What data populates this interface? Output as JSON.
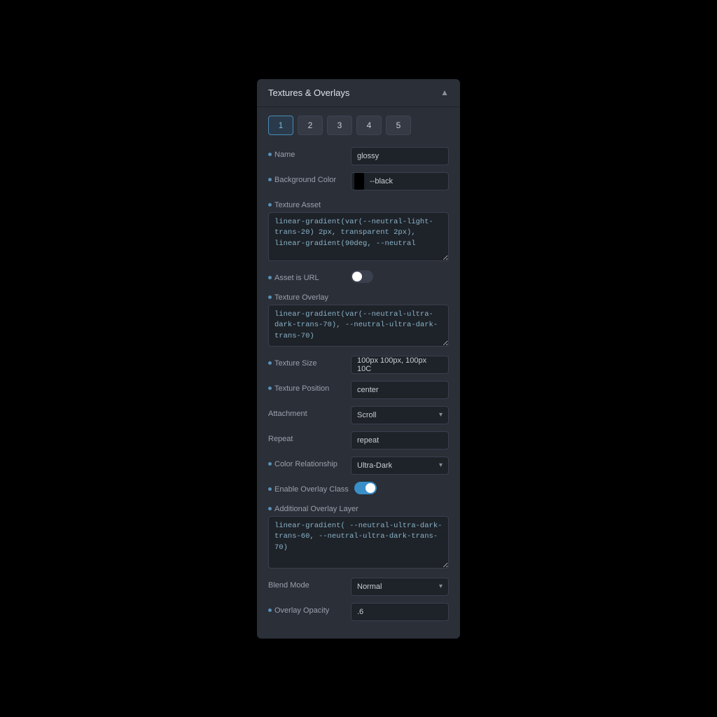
{
  "panel": {
    "title": "Textures & Overlays",
    "chevron": "▲",
    "tabs": [
      {
        "label": "1",
        "active": true
      },
      {
        "label": "2",
        "active": false
      },
      {
        "label": "3",
        "active": false
      },
      {
        "label": "4",
        "active": false
      },
      {
        "label": "5",
        "active": false
      }
    ]
  },
  "fields": {
    "name_label": "Name",
    "name_value": "glossy",
    "bg_color_label": "Background Color",
    "bg_color_value": "--black",
    "texture_asset_label": "Texture Asset",
    "texture_asset_value": "linear-gradient(var(--neutral-light-trans-20) 2px, transparent 2px),\nlinear-gradient(90deg, --neutral",
    "asset_is_url_label": "Asset is URL",
    "texture_overlay_label": "Texture Overlay",
    "texture_overlay_value": "linear-gradient(var(--neutral-ultra-dark-trans-70), --neutral-ultra-dark-trans-70)",
    "texture_size_label": "Texture Size",
    "texture_size_value": "100px 100px, 100px 10C",
    "texture_position_label": "Texture Position",
    "texture_position_value": "center",
    "attachment_label": "Attachment",
    "attachment_value": "Scroll",
    "repeat_label": "Repeat",
    "repeat_value": "repeat",
    "color_relationship_label": "Color Relationship",
    "color_relationship_value": "Ultra-Dark",
    "enable_overlay_label": "Enable Overlay Class",
    "additional_overlay_label": "Additional Overlay Layer",
    "additional_overlay_value": "linear-gradient( --neutral-ultra-dark-trans-60, --neutral-ultra-dark-trans-70)",
    "blend_mode_label": "Blend Mode",
    "blend_mode_value": "Normal",
    "overlay_opacity_label": "Overlay Opacity",
    "overlay_opacity_value": ".6"
  },
  "colors": {
    "swatch_black": "#000000",
    "dot": "#5a8fb5",
    "toggle_off": "#3a404d",
    "toggle_on": "#3a8fc8"
  }
}
